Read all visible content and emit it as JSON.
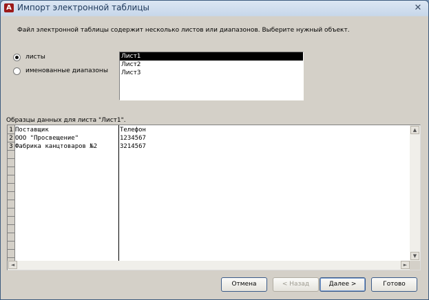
{
  "window": {
    "title": "Импорт электронной таблицы",
    "close_glyph": "✕",
    "icon": "access-app-icon"
  },
  "intro_text": "Файл электронной таблицы содержит несколько листов или диапазонов.  Выберите нужный объект.",
  "options": {
    "sheets_label": "листы",
    "ranges_label": "именованные диапазоны",
    "selected": "листы"
  },
  "sheet_list": {
    "items": [
      "Лист1",
      "Лист2",
      "Лист3"
    ],
    "selected": "Лист1"
  },
  "sample": {
    "label": "Образцы данных для листа \"Лист1\".",
    "row_numbers": [
      "1",
      "2",
      "3"
    ],
    "rows": [
      [
        "Поставщик",
        "Телефон"
      ],
      [
        "ООО \"Просвещение\"",
        "1234567"
      ],
      [
        "Фабрика канцтоваров №2",
        "3214567"
      ]
    ]
  },
  "buttons": {
    "cancel": "Отмена",
    "back": "< Назад",
    "next": "Далее >",
    "finish": "Готово"
  }
}
